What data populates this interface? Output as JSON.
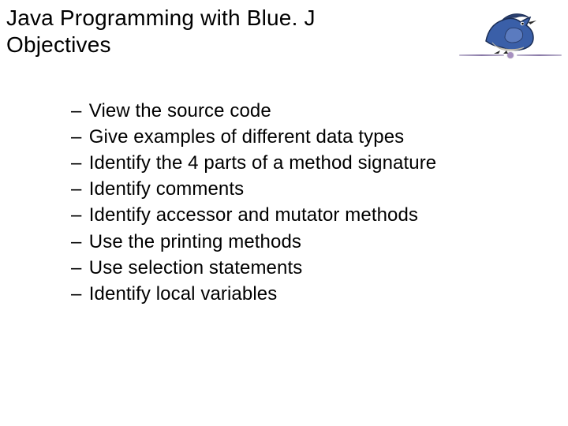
{
  "header": {
    "title_line1": "Java Programming with Blue. J",
    "title_line2": "Objectives"
  },
  "logo": {
    "name": "bluej-bird-logo"
  },
  "bullets": {
    "dash": "–",
    "items": [
      "View the source code",
      "Give examples of different data types",
      "Identify the 4 parts of a method signature",
      "Identify comments",
      "Identify accessor and mutator methods",
      "Use the printing methods",
      "Use selection statements",
      "Identify local variables"
    ]
  }
}
